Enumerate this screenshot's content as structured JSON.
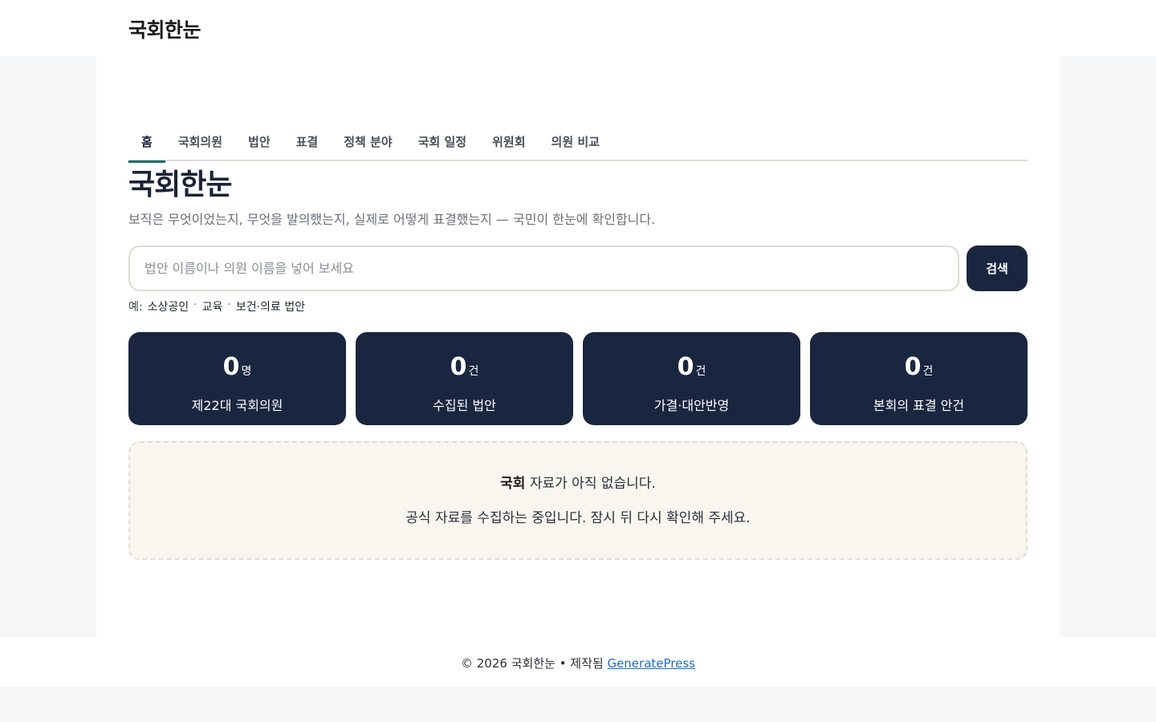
{
  "header": {
    "site_title": "국회한눈"
  },
  "nav": {
    "tabs": [
      {
        "label": "홈",
        "active": true
      },
      {
        "label": "국회의원",
        "active": false
      },
      {
        "label": "법안",
        "active": false
      },
      {
        "label": "표결",
        "active": false
      },
      {
        "label": "정책 분야",
        "active": false
      },
      {
        "label": "국회 일정",
        "active": false
      },
      {
        "label": "위원회",
        "active": false
      },
      {
        "label": "의원 비교",
        "active": false
      }
    ]
  },
  "hero": {
    "title": "국회한눈",
    "subtitle": "보직은 무엇이었는지, 무엇을 발의했는지, 실제로 어떻게 표결했는지 — 국민이 한눈에 확인합니다."
  },
  "search": {
    "placeholder": "법안 이름이나 의원 이름을 넣어 보세요",
    "value": "",
    "button_label": "검색",
    "examples_prefix": "예:",
    "examples": [
      "소상공인",
      "교육",
      "보건·의료 법안"
    ],
    "separator": "·"
  },
  "stats": [
    {
      "value": "0",
      "unit": "명",
      "label": "제22대 국회의원"
    },
    {
      "value": "0",
      "unit": "건",
      "label": "수집된 법안"
    },
    {
      "value": "0",
      "unit": "건",
      "label": "가결·대안반영"
    },
    {
      "value": "0",
      "unit": "건",
      "label": "본회의 표결 안건"
    }
  ],
  "empty_state": {
    "bold": "국회",
    "line1_rest": " 자료가 아직 없습니다.",
    "line2": "공식 자료를 수집하는 중입니다. 잠시 뒤 다시 확인해 주세요."
  },
  "footer": {
    "text": "© 2026 국회한눈 • 제작됨 ",
    "link": "GeneratePress"
  },
  "colors": {
    "primary_dark": "#1a2640",
    "accent_teal": "#1c6e68",
    "link_blue": "#1e6fc4",
    "empty_bg": "#f9f6f0"
  }
}
